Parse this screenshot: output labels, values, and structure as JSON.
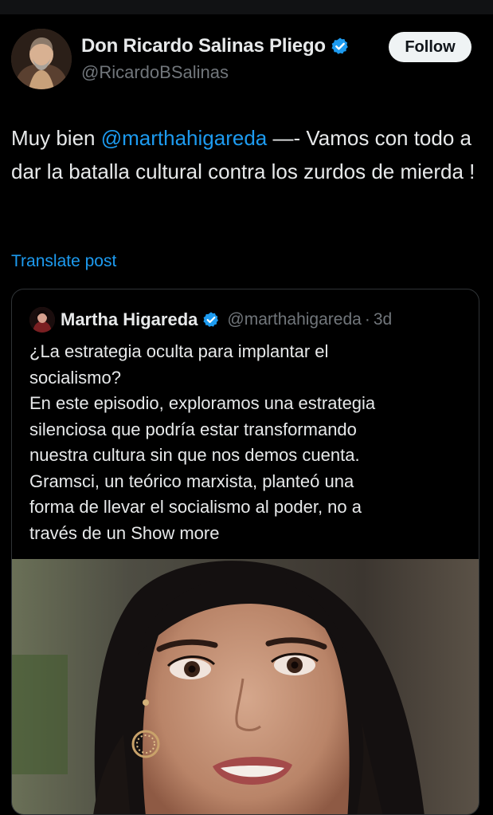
{
  "author": {
    "display_name": "Don Ricardo Salinas Pliego",
    "handle": "@RicardoBSalinas",
    "verified_icon": "verified-badge-icon",
    "avatar_icon": "avatar"
  },
  "follow_label": "Follow",
  "post": {
    "text_before": "Muy bien ",
    "mention": "@marthahigareda",
    "text_after": " —- Vamos con todo a dar la batalla cultural contra los zurdos de mierda !"
  },
  "translate_label": "Translate post",
  "quote": {
    "display_name": "Martha Higareda",
    "handle": "@marthahigareda",
    "separator": "·",
    "time": "3d",
    "lines": [
      "¿La estrategia oculta para implantar el",
      "socialismo?",
      "En este episodio, exploramos una estrategia",
      "silenciosa que podría estar transformando",
      "nuestra cultura sin que nos demos cuenta.",
      "Gramsci, un teórico marxista, planteó una",
      "forma de llevar el socialismo al poder, no a"
    ],
    "last_line_text": "través de un ",
    "show_more": "Show more"
  },
  "colors": {
    "background": "#000000",
    "text": "#e7e9ea",
    "secondary": "#71767b",
    "accent": "#1d9bf0",
    "border": "#2f3336",
    "follow_bg": "#eff3f4"
  }
}
